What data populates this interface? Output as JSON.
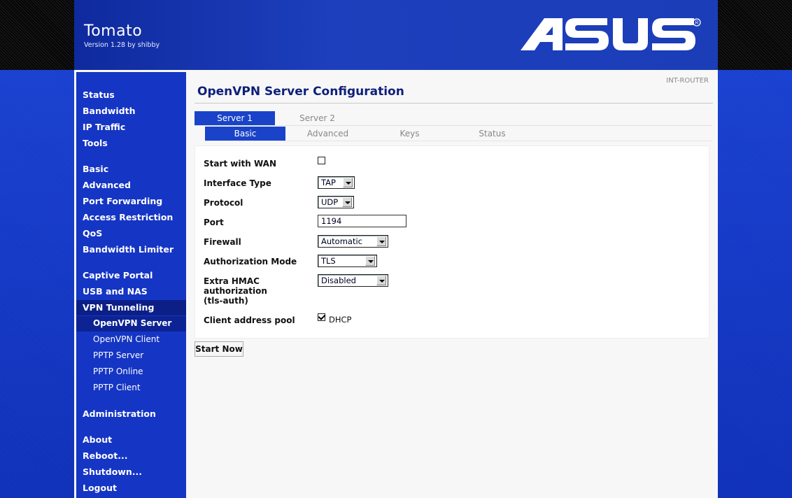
{
  "header": {
    "title": "Tomato",
    "version": "Version 1.28 by shibby",
    "logo_text": "ASUS"
  },
  "router_name": "INT-ROUTER",
  "sidebar": {
    "groups": [
      [
        "Status",
        "Bandwidth",
        "IP Traffic",
        "Tools"
      ],
      [
        "Basic",
        "Advanced",
        "Port Forwarding",
        "Access Restriction",
        "QoS",
        "Bandwidth Limiter"
      ],
      [
        "Captive Portal",
        "USB and NAS",
        "VPN Tunneling"
      ],
      [
        "OpenVPN Server",
        "OpenVPN Client",
        "PPTP Server",
        "PPTP Online",
        "PPTP Client"
      ],
      [
        "Administration"
      ],
      [
        "About",
        "Reboot...",
        "Shutdown...",
        "Logout"
      ]
    ],
    "active_section": "VPN Tunneling",
    "active_item": "OpenVPN Server"
  },
  "page_title": "OpenVPN Server Configuration",
  "server_tabs": [
    "Server 1",
    "Server 2"
  ],
  "section_tabs": [
    "Basic",
    "Advanced",
    "Keys",
    "Status"
  ],
  "form": {
    "start_with_wan": {
      "label": "Start with WAN",
      "checked": false
    },
    "interface_type": {
      "label": "Interface Type",
      "value": "TAP"
    },
    "protocol": {
      "label": "Protocol",
      "value": "UDP"
    },
    "port": {
      "label": "Port",
      "value": "1194"
    },
    "firewall": {
      "label": "Firewall",
      "value": "Automatic"
    },
    "authorization_mode": {
      "label": "Authorization Mode",
      "value": "TLS"
    },
    "extra_hmac": {
      "label_lines": [
        "Extra HMAC",
        "authorization",
        "(tls-auth)"
      ],
      "value": "Disabled"
    },
    "client_pool": {
      "label": "Client address pool",
      "option": "DHCP",
      "checked": true
    }
  },
  "start_button": "Start Now"
}
